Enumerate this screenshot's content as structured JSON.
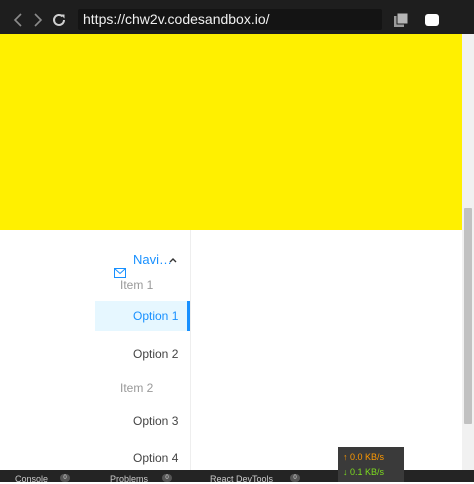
{
  "browser": {
    "url": "https://chw2v.codesandbox.io/",
    "icons": {
      "back": "chevron-left-icon",
      "forward": "chevron-right-icon",
      "reload": "reload-icon",
      "copy": "copy-icon",
      "window": "window-icon"
    }
  },
  "colors": {
    "banner": "#fff000",
    "accent": "#1890ff",
    "selected_bg": "#e6f7ff"
  },
  "menu": {
    "submenu": {
      "label": "Navi…",
      "icon": "mail-icon",
      "caret": "caret-up-icon"
    },
    "groups": [
      {
        "title": "Item 1",
        "items": [
          {
            "label": "Option 1",
            "selected": true
          },
          {
            "label": "Option 2",
            "selected": false
          }
        ]
      },
      {
        "title": "Item 2",
        "items": [
          {
            "label": "Option 3",
            "selected": false
          },
          {
            "label": "Option 4",
            "selected": false
          }
        ]
      }
    ]
  },
  "devtools": {
    "tabs": [
      {
        "label": "Console",
        "badge": "0"
      },
      {
        "label": "Problems",
        "badge": "0"
      },
      {
        "label": "React DevTools",
        "badge": "0"
      }
    ]
  },
  "network": {
    "up": "↑ 0.0 KB/s",
    "down": "↓ 0.1 KB/s"
  }
}
